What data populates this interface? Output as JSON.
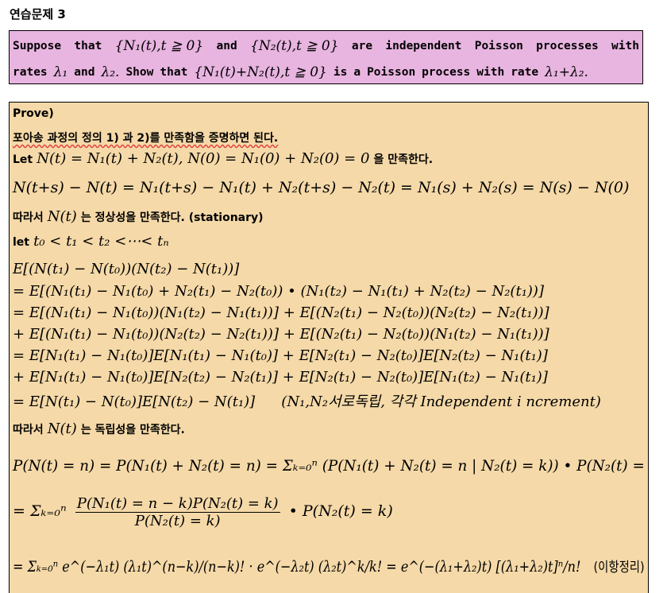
{
  "title": "연습문제 3",
  "problem": {
    "line1": [
      "Suppose",
      "that",
      "{N₁(t),t ≧ 0}",
      "and",
      "{N₂(t),t ≧ 0}",
      "are",
      "independent",
      "Poisson",
      "processes",
      "with"
    ],
    "line2": [
      "rates",
      "λ₁",
      "and",
      "λ₂.",
      "Show",
      "that",
      "{N₁(t)+N₂(t),t ≧ 0}",
      "is",
      "a",
      "Poisson",
      "process",
      "with",
      "rate",
      "λ₁+λ₂."
    ]
  },
  "proof": {
    "l01": "Prove)",
    "l02": "포아송 과정의 정의 1) 과 2)를 만족함을 증명하면 된다.",
    "l03a": "Let",
    "l03b": "N(t) = N₁(t) + N₂(t),  N(0) = N₁(0) + N₂(0) = 0",
    "l03c": "을 만족한다.",
    "l04": "N(t+s) − N(t) = N₁(t+s) − N₁(t) + N₂(t+s) − N₂(t) = N₁(s) + N₂(s) = N(s) − N(0)",
    "l05a": "따라서",
    "l05b": "N(t)",
    "l05c": "는 정상성을 만족한다. (stationary)",
    "l06a": "let",
    "l06b": "t₀ < t₁ < t₂ <⋯< tₙ",
    "l07": "E[(N(t₁) − N(t₀))(N(t₂) − N(t₁))]",
    "l08": "= E[(N₁(t₁) − N₁(t₀) + N₂(t₁) − N₂(t₀)) • (N₁(t₂) − N₁(t₁) + N₂(t₂) − N₂(t₁))]",
    "l09": "= E[(N₁(t₁) − N₁(t₀))(N₁(t₂) − N₁(t₁))] + E[(N₂(t₁) − N₂(t₀))(N₂(t₂) − N₂(t₁))]",
    "l10": "+ E[(N₁(t₁) − N₁(t₀))(N₂(t₂) − N₂(t₁))] + E[(N₂(t₁) − N₂(t₀))(N₁(t₂) − N₁(t₁))]",
    "l11": "= E[N₁(t₁) − N₁(t₀)]E[N₁(t₁) − N₁(t₀)] + E[N₂(t₁) − N₂(t₀)]E[N₂(t₂) − N₁(t₁)]",
    "l12": "+ E[N₁(t₁) − N₁(t₀)]E[N₂(t₂) − N₂(t₁)] + E[N₂(t₁) − N₂(t₀)]E[N₁(t₂) − N₁(t₁)]",
    "l13a": "= E[N(t₁) − N(t₀)]E[N(t₂) − N(t₁)]",
    "l13b": "(N₁,N₂서로독립, 각각 Independent i ncrement)",
    "l14a": "따라서",
    "l14b": "N(t)",
    "l14c": "는 독립성을 만족한다.",
    "l15": "P(N(t) = n) = P(N₁(t) + N₂(t) = n) = Σₖ₌₀ⁿ (P(N₁(t) + N₂(t) = n | N₂(t) = k)) • P(N₂(t) =",
    "l16a": "= Σₖ₌₀ⁿ",
    "l16num": "P(N₁(t) = n − k)P(N₂(t) = k)",
    "l16den": "P(N₂(t) = k)",
    "l16b": "• P(N₂(t) = k)",
    "l17a": "= Σₖ₌₀ⁿ e^(−λ₁t) (λ₁t)^(n−k)/(n−k)! · e^(−λ₂t) (λ₂t)^k/k! = e^(−(λ₁+λ₂)t) [(λ₁+λ₂)t]ⁿ/n!",
    "l17b": "(이항정리)"
  }
}
